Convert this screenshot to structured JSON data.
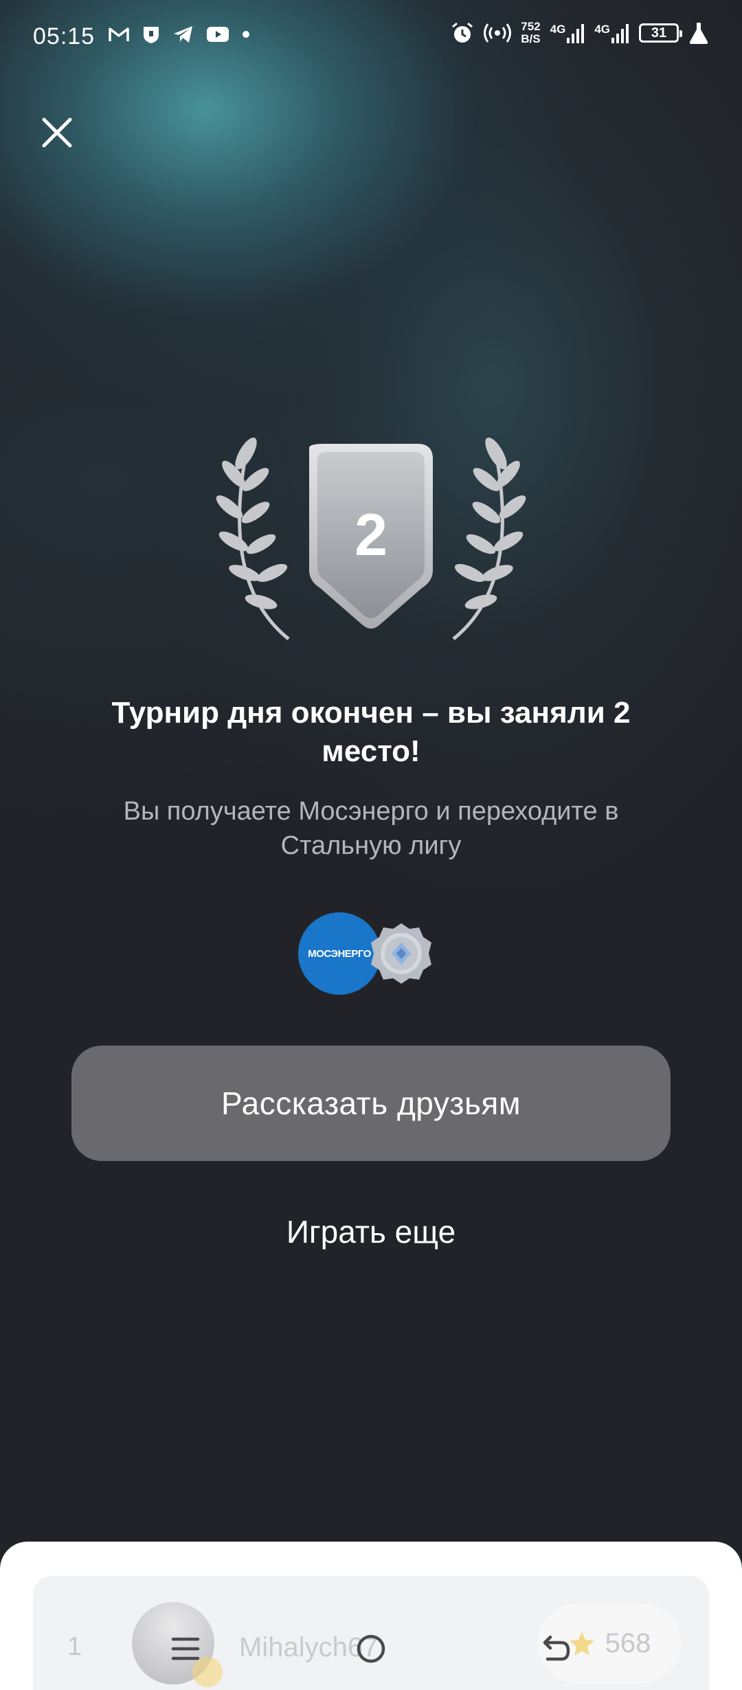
{
  "status_bar": {
    "time": "05:15",
    "net_speed_value": "752",
    "net_speed_unit": "B/S",
    "net_type_1": "4G",
    "net_type_2": "4G",
    "battery": "31",
    "left_icons": [
      "gmail-icon",
      "shield-app-icon",
      "telegram-icon",
      "youtube-icon",
      "dot-icon"
    ],
    "right_icons": [
      "alarm-icon",
      "hotspot-icon",
      "signal-icon",
      "signal-icon",
      "battery-icon",
      "lab-icon"
    ]
  },
  "award": {
    "place": "2"
  },
  "result": {
    "title": "Турнир дня окончен – вы заняли 2 место!",
    "subtitle": "Вы получаете Мосэнерго и переходите в Стальную лигу"
  },
  "rewards": {
    "sponsor_name": "МОСЭНЕРГО",
    "league_icon": "steel-league-badge-icon"
  },
  "actions": {
    "share_label": "Рассказать друзьям",
    "play_again_label": "Играть еще"
  },
  "leaderboard": {
    "rows": [
      {
        "rank": "1",
        "name": "Mihalych67",
        "score": "568"
      }
    ]
  },
  "colors": {
    "background": "#222328",
    "accent_teal": "#4a98a0",
    "button_bg": "#6a6a6e",
    "sponsor_blue": "#1a76c9"
  }
}
